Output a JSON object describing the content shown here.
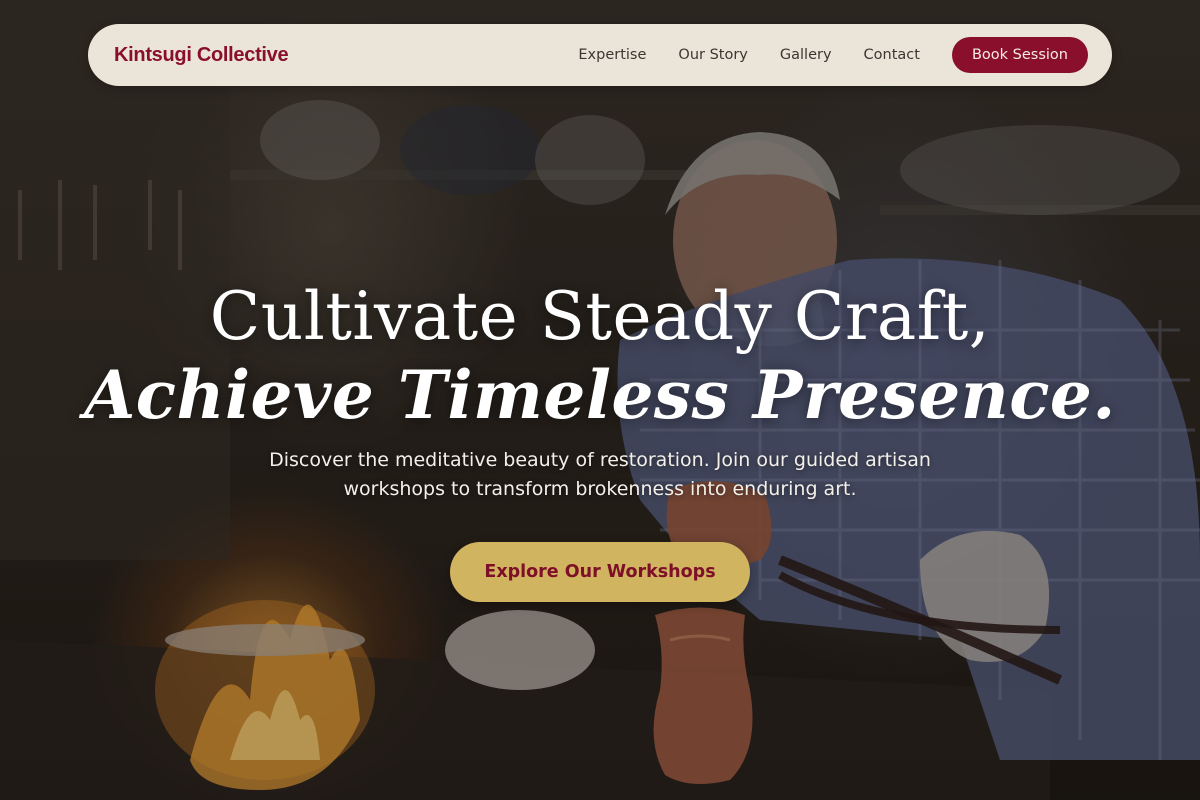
{
  "nav": {
    "brand": "Kintsugi Collective",
    "links": [
      "Expertise",
      "Our Story",
      "Gallery",
      "Contact"
    ],
    "cta": "Book Session"
  },
  "hero": {
    "title_line1": "Cultivate Steady Craft,",
    "title_line2": "Achieve Timeless Presence.",
    "subtitle": "Discover the meditative beauty of restoration. Join our guided artisan workshops to transform brokenness into enduring art.",
    "cta": "Explore Our Workshops",
    "background_image": "artisan-coppersmith-photo"
  },
  "colors": {
    "brand": "#8a0f2c",
    "nav_bg": "#ebe5d9",
    "cta_gold": "#d1b45f",
    "hero_text": "#ffffff"
  }
}
